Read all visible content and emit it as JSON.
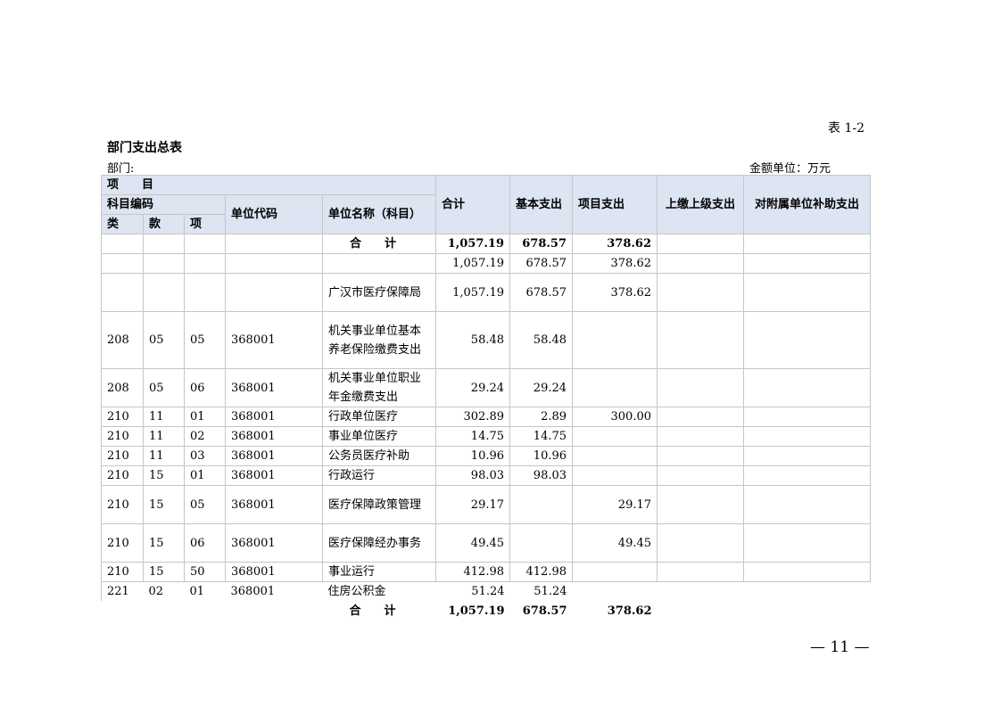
{
  "table_no": "表 1-2",
  "title": "部门支出总表",
  "dept_label": "部门:",
  "unit_label": "金额单位：万元",
  "page_number": "— 11 —",
  "header": {
    "project": "项　　目",
    "code": "科目编码",
    "lei": "类",
    "kuan": "款",
    "xiang": "项",
    "unit_code": "单位代码",
    "unit_name": "单位名称（科目）",
    "total": "合计",
    "basic": "基本支出",
    "proj": "项目支出",
    "upper": "上缴上级支出",
    "subsidy": "对附属单位补助支出"
  },
  "sum_label": "合　　计",
  "summary": {
    "total": "1,057.19",
    "basic": "678.57",
    "proj": "378.62"
  },
  "rows": [
    {
      "lei": "",
      "kuan": "",
      "xiang": "",
      "code": "",
      "name": "",
      "total": "1,057.19",
      "basic": "678.57",
      "proj": "378.62",
      "upper": "",
      "sub": ""
    },
    {
      "lei": "",
      "kuan": "",
      "xiang": "",
      "code": "",
      "name": "广汉市医疗保障局",
      "total": "1,057.19",
      "basic": "678.57",
      "proj": "378.62",
      "upper": "",
      "sub": ""
    },
    {
      "lei": "208",
      "kuan": "05",
      "xiang": "05",
      "code": "368001",
      "name": "机关事业单位基本养老保险缴费支出",
      "total": "58.48",
      "basic": "58.48",
      "proj": "",
      "upper": "",
      "sub": ""
    },
    {
      "lei": "208",
      "kuan": "05",
      "xiang": "06",
      "code": "368001",
      "name": "机关事业单位职业年金缴费支出",
      "total": "29.24",
      "basic": "29.24",
      "proj": "",
      "upper": "",
      "sub": ""
    },
    {
      "lei": "210",
      "kuan": "11",
      "xiang": "01",
      "code": "368001",
      "name": "行政单位医疗",
      "total": "302.89",
      "basic": "2.89",
      "proj": "300.00",
      "upper": "",
      "sub": ""
    },
    {
      "lei": "210",
      "kuan": "11",
      "xiang": "02",
      "code": "368001",
      "name": "事业单位医疗",
      "total": "14.75",
      "basic": "14.75",
      "proj": "",
      "upper": "",
      "sub": ""
    },
    {
      "lei": "210",
      "kuan": "11",
      "xiang": "03",
      "code": "368001",
      "name": "公务员医疗补助",
      "total": "10.96",
      "basic": "10.96",
      "proj": "",
      "upper": "",
      "sub": ""
    },
    {
      "lei": "210",
      "kuan": "15",
      "xiang": "01",
      "code": "368001",
      "name": "行政运行",
      "total": "98.03",
      "basic": "98.03",
      "proj": "",
      "upper": "",
      "sub": ""
    },
    {
      "lei": "210",
      "kuan": "15",
      "xiang": "05",
      "code": "368001",
      "name": "医疗保障政策管理",
      "total": "29.17",
      "basic": "",
      "proj": "29.17",
      "upper": "",
      "sub": ""
    },
    {
      "lei": "210",
      "kuan": "15",
      "xiang": "06",
      "code": "368001",
      "name": "医疗保障经办事务",
      "total": "49.45",
      "basic": "",
      "proj": "49.45",
      "upper": "",
      "sub": ""
    },
    {
      "lei": "210",
      "kuan": "15",
      "xiang": "50",
      "code": "368001",
      "name": "事业运行",
      "total": "412.98",
      "basic": "412.98",
      "proj": "",
      "upper": "",
      "sub": ""
    }
  ],
  "last_row": {
    "lei": "221",
    "kuan": "02",
    "xiang": "01",
    "code": "368001",
    "name": "住房公积金",
    "total": "51.24",
    "basic": "51.24",
    "proj": ""
  }
}
